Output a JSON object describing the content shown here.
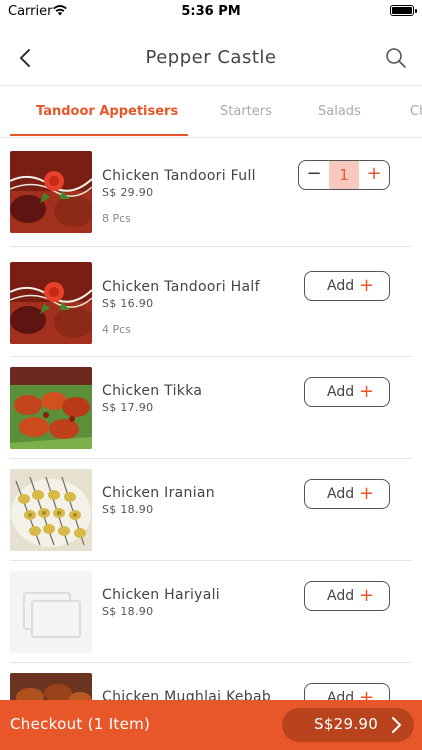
{
  "status_bar": {
    "carrier": "Carrier",
    "time": "5:36 PM"
  },
  "header": {
    "title": "Pepper Castle"
  },
  "tabs": [
    {
      "label": "Tandoor Appetisers",
      "active": true
    },
    {
      "label": "Starters",
      "active": false
    },
    {
      "label": "Salads",
      "active": false
    },
    {
      "label": "Ch",
      "active": false
    }
  ],
  "items": [
    {
      "name": "Chicken Tandoori Full",
      "price": "S$ 29.90",
      "pieces": "8 Pcs",
      "quantity": "1",
      "image": "tandoori-chicken-image"
    },
    {
      "name": "Chicken Tandoori Half",
      "price": "S$ 16.90",
      "pieces": "4 Pcs",
      "add_label": "Add",
      "image": "tandoori-chicken-image"
    },
    {
      "name": "Chicken Tikka",
      "price": "S$ 17.90",
      "add_label": "Add",
      "image": "chicken-tikka-image"
    },
    {
      "name": "Chicken Iranian",
      "price": "S$ 18.90",
      "add_label": "Add",
      "image": "chicken-iranian-image"
    },
    {
      "name": "Chicken Hariyali",
      "price": "S$ 18.90",
      "add_label": "Add",
      "image": "placeholder-image-icon"
    },
    {
      "name": "Chicken Mughlai Kebab",
      "add_label": "Add",
      "image": "kebab-image"
    }
  ],
  "footer": {
    "checkout_label": "Checkout (1 Item)",
    "total": "S$29.90"
  },
  "colors": {
    "accent": "#e8572a",
    "accent_dark": "#b8431d",
    "qty_bg": "#f7c8bd"
  }
}
